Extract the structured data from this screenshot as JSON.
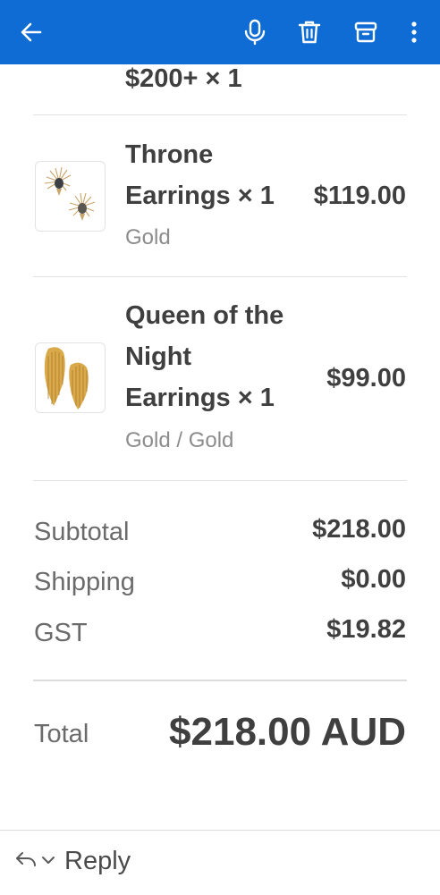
{
  "toolbar": {
    "back_icon": "arrow-left-icon",
    "mic_icon": "microphone-icon",
    "delete_icon": "trash-icon",
    "archive_icon": "archive-icon",
    "more_icon": "more-vertical-icon",
    "bar_color": "#0f6cd4"
  },
  "order": {
    "partial_item_line": "$200+ × 1",
    "items": [
      {
        "title": "Throne Earrings × 1",
        "variant": "Gold",
        "price": "$119.00"
      },
      {
        "title": "Queen of the Night Earrings × 1",
        "variant": "Gold / Gold",
        "price": "$99.00"
      }
    ],
    "summary": {
      "subtotal_label": "Subtotal",
      "subtotal_value": "$218.00",
      "shipping_label": "Shipping",
      "shipping_value": "$0.00",
      "tax_label": "GST",
      "tax_value": "$19.82",
      "total_label": "Total",
      "total_value": "$218.00 AUD"
    }
  },
  "footer": {
    "reply_label": "Reply"
  }
}
